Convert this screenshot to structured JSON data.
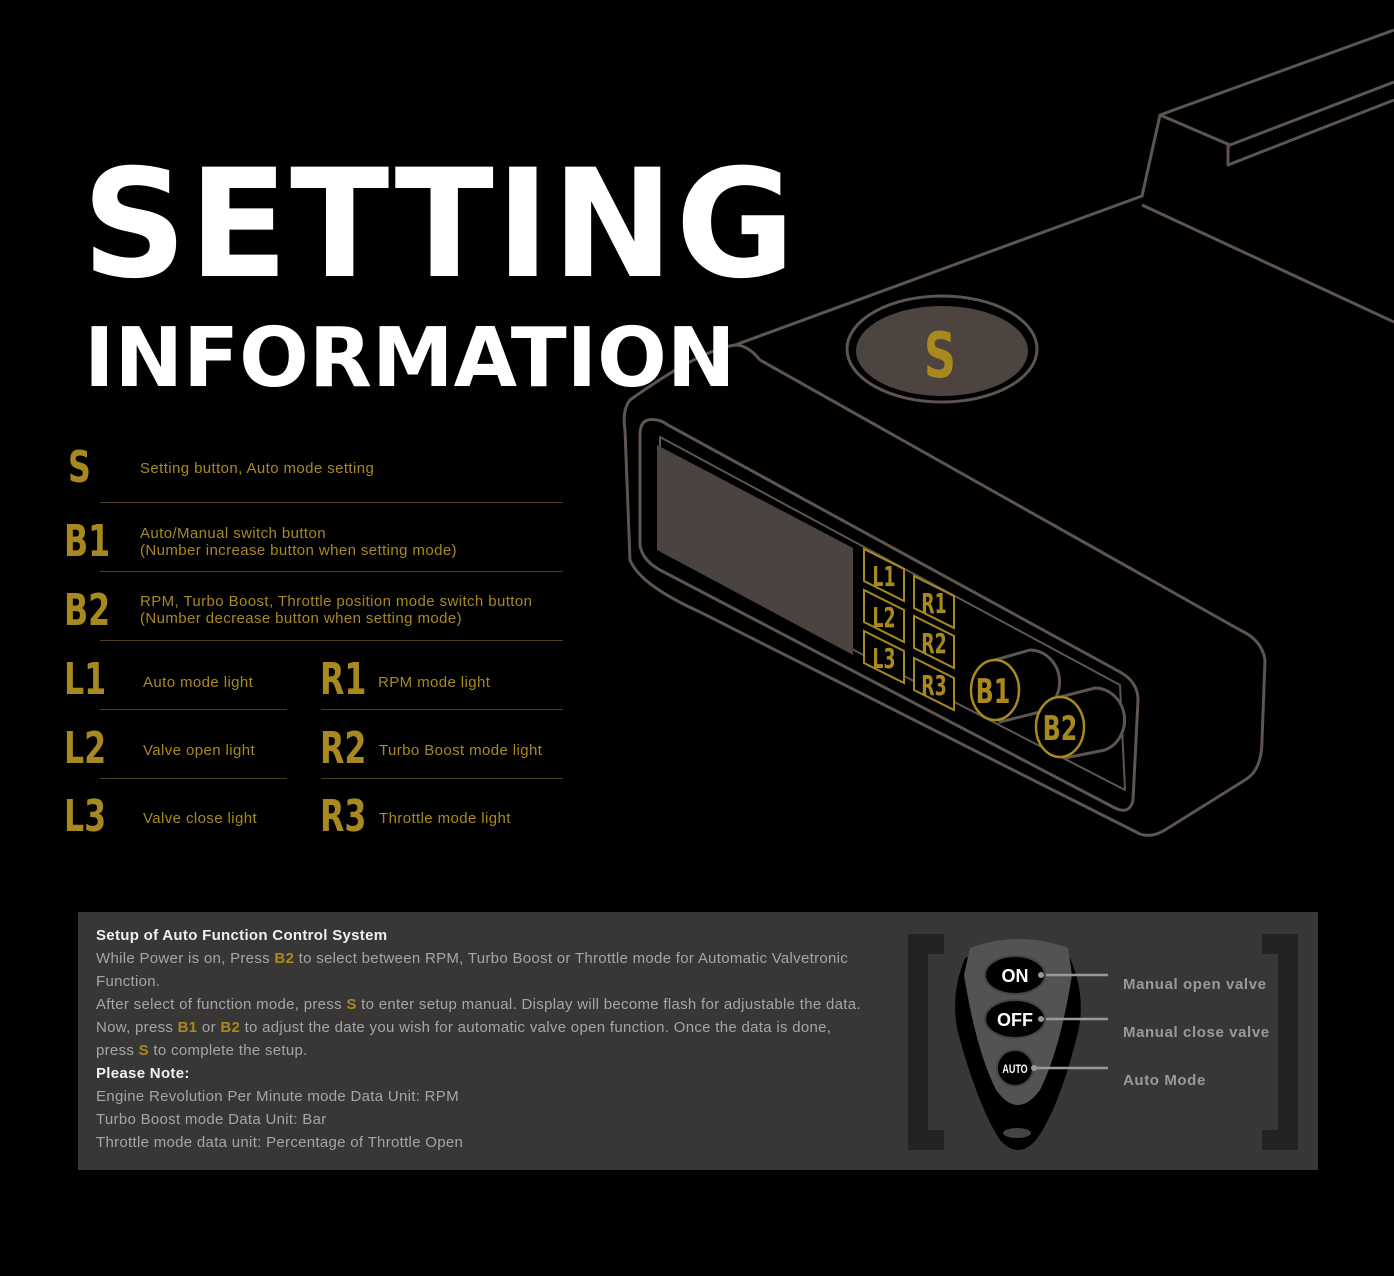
{
  "title": {
    "line1": "SETTING",
    "line2": "INFORMATION"
  },
  "device": {
    "s_button": "S",
    "b1": "B1",
    "b2": "B2",
    "lights": [
      "L1",
      "L2",
      "L3",
      "R1",
      "R2",
      "R3"
    ]
  },
  "legend": {
    "rows": [
      {
        "key": "S",
        "text": "Setting button, Auto mode setting"
      },
      {
        "key": "B1",
        "text": "Auto/Manual switch button",
        "text2": "(Number increase button when setting mode)"
      },
      {
        "key": "B2",
        "text": "RPM, Turbo Boost, Throttle position mode switch button",
        "text2": "(Number decrease button when setting mode)"
      }
    ],
    "left": [
      {
        "key": "L1",
        "text": "Auto mode light"
      },
      {
        "key": "L2",
        "text": "Valve open light"
      },
      {
        "key": "L3",
        "text": "Valve close light"
      }
    ],
    "right": [
      {
        "key": "R1",
        "text": "RPM mode light"
      },
      {
        "key": "R2",
        "text": "Turbo Boost mode light"
      },
      {
        "key": "R3",
        "text": "Throttle mode light"
      }
    ]
  },
  "setup": {
    "heading": "Setup of Auto Function Control System",
    "l1a": "While Power is on, Press ",
    "l1b": "B2",
    "l1c": " to select between RPM, Turbo Boost or Throttle mode for Automatic Valvetronic",
    "l2": "Function.",
    "l3a": "After select of function mode, press ",
    "l3b": "S",
    "l3c": " to enter setup manual. Display will become flash for adjustable the data.",
    "l4a": "Now, press ",
    "l4b": "B1",
    "l4c": " or ",
    "l4d": "B2",
    "l4e": " to adjust the date you wish for automatic valve open function. Once the data is done,",
    "l5a": "press ",
    "l5b": "S",
    "l5c": " to complete the setup.",
    "note": "Please Note:",
    "n1": "Engine Revolution Per Minute mode Data Unit: RPM",
    "n2": "Turbo Boost mode Data Unit: Bar",
    "n3": "Throttle mode data unit: Percentage of Throttle Open"
  },
  "remote": {
    "buttons": [
      "ON",
      "OFF",
      "AUTO"
    ],
    "labels": [
      "Manual open valve",
      "Manual close valve",
      "Auto Mode"
    ]
  },
  "colors": {
    "gold": "#a8891f",
    "outline": "#5e5450",
    "panel": "#393735"
  }
}
